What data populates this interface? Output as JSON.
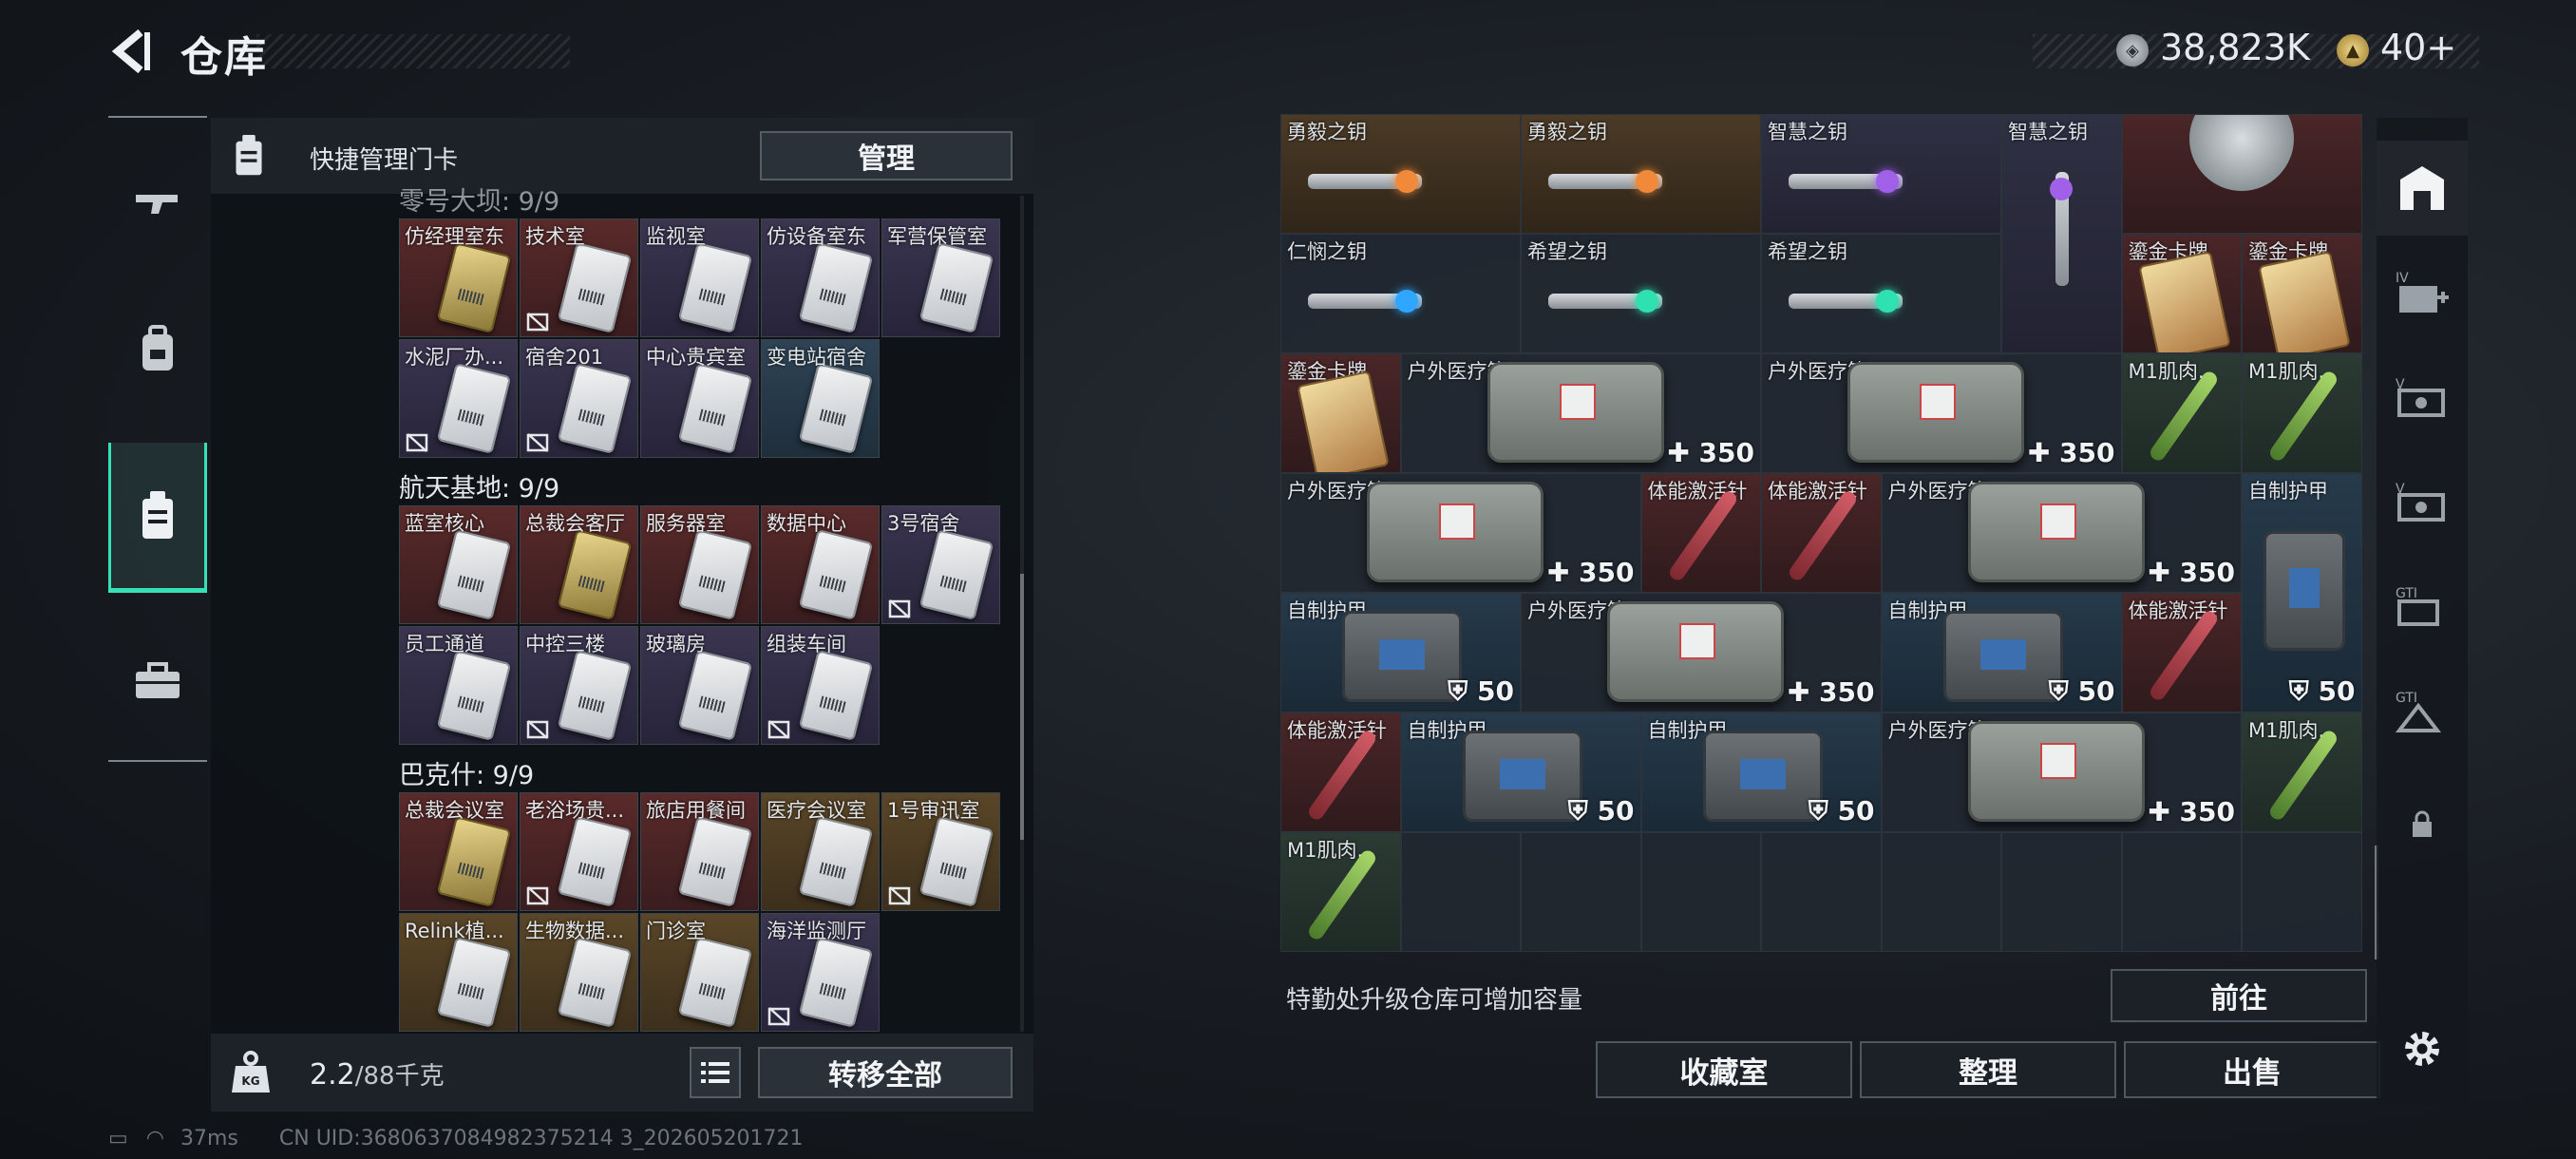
{
  "header": {
    "title": "仓库",
    "currency1_value": "38,823K",
    "currency2_value": "40+",
    "tiny_text": "..."
  },
  "left_tabs": [
    {
      "name": "weapons",
      "icon": "gun-icon"
    },
    {
      "name": "gear",
      "icon": "backpack-icon"
    },
    {
      "name": "keycards",
      "icon": "keycard-icon",
      "active": true
    },
    {
      "name": "equipment",
      "icon": "briefcase-icon"
    }
  ],
  "left_panel": {
    "header_text": "快捷管理门卡",
    "manage_label": "管理",
    "partial_group_title": "零号大坝: 9/9",
    "groups": [
      {
        "title": "航天基地: 9/9",
        "cards": [
          {
            "label": "蓝室核心",
            "bg": "red",
            "gold": false,
            "no_fix": false
          },
          {
            "label": "总裁会客厅",
            "bg": "red",
            "gold": true,
            "no_fix": false
          },
          {
            "label": "服务器室",
            "bg": "red",
            "gold": false,
            "no_fix": false
          },
          {
            "label": "数据中心",
            "bg": "red",
            "gold": false,
            "no_fix": false
          },
          {
            "label": "3号宿舍",
            "bg": "purple",
            "gold": false,
            "no_fix": true
          },
          {
            "label": "员工通道",
            "bg": "purple",
            "gold": false,
            "no_fix": false
          },
          {
            "label": "中控三楼",
            "bg": "purple",
            "gold": false,
            "no_fix": true
          },
          {
            "label": "玻璃房",
            "bg": "purple",
            "gold": false,
            "no_fix": false
          },
          {
            "label": "组装车间",
            "bg": "purple",
            "gold": false,
            "no_fix": true
          }
        ]
      },
      {
        "title": "巴克什: 9/9",
        "cards": [
          {
            "label": "总裁会议室",
            "bg": "red",
            "gold": true,
            "no_fix": false
          },
          {
            "label": "老浴场贵...",
            "bg": "red",
            "gold": false,
            "no_fix": true
          },
          {
            "label": "旅店用餐间",
            "bg": "red",
            "gold": false,
            "no_fix": false
          },
          {
            "label": "医疗会议室",
            "bg": "gold",
            "gold": false,
            "no_fix": false
          },
          {
            "label": "1号审讯室",
            "bg": "gold",
            "gold": false,
            "no_fix": true
          },
          {
            "label": "Relink植...",
            "bg": "gold",
            "gold": false,
            "no_fix": false
          },
          {
            "label": "生物数据...",
            "bg": "gold",
            "gold": false,
            "no_fix": false
          },
          {
            "label": "门诊室",
            "bg": "gold",
            "gold": false,
            "no_fix": false
          },
          {
            "label": "海洋监测厅",
            "bg": "purple",
            "gold": false,
            "no_fix": true
          }
        ]
      }
    ],
    "top_cards": [
      {
        "label": "仿经理室东",
        "bg": "red",
        "gold": true,
        "no_fix": false
      },
      {
        "label": "技术室",
        "bg": "red",
        "gold": false,
        "no_fix": true
      },
      {
        "label": "监视室",
        "bg": "purple",
        "gold": false,
        "no_fix": false
      },
      {
        "label": "仿设备室东",
        "bg": "purple",
        "gold": false,
        "no_fix": false
      },
      {
        "label": "军营保管室",
        "bg": "purple",
        "gold": false,
        "no_fix": false
      },
      {
        "label": "水泥厂办...",
        "bg": "purple",
        "gold": false,
        "no_fix": true
      },
      {
        "label": "宿舍201",
        "bg": "purple",
        "gold": false,
        "no_fix": true
      },
      {
        "label": "中心贵宾室",
        "bg": "purple",
        "gold": false,
        "no_fix": false
      },
      {
        "label": "变电站宿舍",
        "bg": "blue",
        "gold": false,
        "no_fix": false
      }
    ],
    "weight_value": "2.2",
    "weight_unit": "/88千克",
    "transfer_label": "转移全部"
  },
  "right_panel": {
    "keys_row0": [
      "勇毅之钥",
      "勇毅之钥",
      "智慧之钥",
      "智慧之钥"
    ],
    "items": {
      "key_renmin": "仁悯之钥",
      "key_hope1": "希望之钥",
      "key_hope2": "希望之钥",
      "gold_card1": "鎏金卡牌",
      "gold_card2": "鎏金卡牌",
      "gold_card3": "鎏金卡牌",
      "medbox": "户外医疗箱",
      "stim": "体能激活针",
      "armor": "自制护甲",
      "m1": "M1肌肉...",
      "qty_350": "350",
      "qty_50": "50"
    },
    "upgrade_text": "特勤处升级仓库可增加容量",
    "goto_label": "前往",
    "buttons": [
      "收藏室",
      "整理",
      "出售"
    ]
  },
  "right_tabs": [
    {
      "icon": "vault-icon"
    },
    {
      "icon": "medical-plus-icon"
    },
    {
      "icon": "ammo-box-icon"
    },
    {
      "icon": "ammo-box-icon"
    },
    {
      "icon": "gti-icon"
    },
    {
      "icon": "gti-warning-icon"
    },
    {
      "icon": "lock-icon"
    },
    {
      "icon": "settings-gear-icon"
    }
  ],
  "status_bar": {
    "ping": "37ms",
    "uid": "CN UID:3680637084982375214 3_202605201721"
  },
  "colors": {
    "accent": "#37e0b5",
    "panel_bg": "#0e1217",
    "button_bg": "#2a3139"
  }
}
